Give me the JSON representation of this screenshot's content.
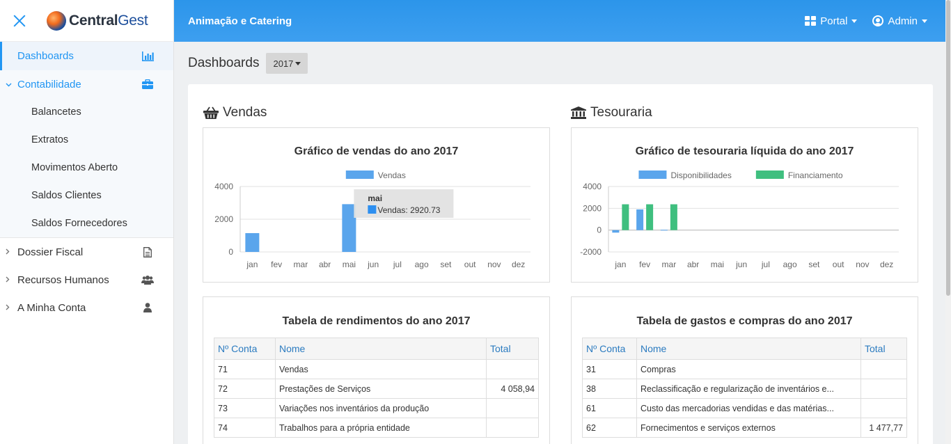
{
  "app": {
    "logo_main": "Central",
    "logo_accent": "Gest",
    "title": "Animação e Catering"
  },
  "topbar": {
    "portal_label": "Portal",
    "admin_label": "Admin"
  },
  "sidebar": {
    "items": [
      {
        "label": "Dashboards",
        "icon": "bar-chart-icon"
      },
      {
        "label": "Contabilidade",
        "icon": "briefcase-icon"
      },
      {
        "label": "Dossier Fiscal",
        "icon": "document-icon"
      },
      {
        "label": "Recursos Humanos",
        "icon": "users-icon"
      },
      {
        "label": "A Minha Conta",
        "icon": "user-icon"
      }
    ],
    "sub_items": [
      "Balancetes",
      "Extratos",
      "Movimentos Aberto",
      "Saldos Clientes",
      "Saldos Fornecedores"
    ]
  },
  "page": {
    "title": "Dashboards",
    "year": "2017"
  },
  "sections": {
    "vendas": "Vendas",
    "tesouraria": "Tesouraria"
  },
  "chart_data": [
    {
      "type": "bar",
      "title": "Gráfico de vendas do ano 2017",
      "categories": [
        "jan",
        "fev",
        "mar",
        "abr",
        "mai",
        "jun",
        "jul",
        "ago",
        "set",
        "out",
        "nov",
        "dez"
      ],
      "series": [
        {
          "name": "Vendas",
          "values": [
            1150,
            0,
            0,
            0,
            2920.73,
            0,
            0,
            0,
            0,
            0,
            0,
            0
          ],
          "color": "#5aa5ec"
        }
      ],
      "yticks": [
        0,
        2000,
        4000
      ],
      "ylim": [
        0,
        4000
      ],
      "legend": "top",
      "grid": true,
      "tooltip": {
        "title": "mai",
        "label": "Vendas: 2920.73",
        "category_index": 4
      }
    },
    {
      "type": "bar",
      "title": "Gráfico de tesouraria líquida do ano 2017",
      "categories": [
        "jan",
        "fev",
        "mar",
        "abr",
        "mai",
        "jun",
        "jul",
        "ago",
        "set",
        "out",
        "nov",
        "dez"
      ],
      "series": [
        {
          "name": "Disponibilidades",
          "values": [
            -230,
            1900,
            30,
            0,
            0,
            0,
            0,
            0,
            0,
            0,
            0,
            0
          ],
          "color": "#5aa5ec"
        },
        {
          "name": "Financiamento",
          "values": [
            2370,
            2370,
            2370,
            0,
            0,
            0,
            0,
            0,
            0,
            0,
            0,
            0
          ],
          "color": "#3fbf7f"
        }
      ],
      "yticks": [
        -2000,
        0,
        2000,
        4000
      ],
      "ylim": [
        -2000,
        4000
      ],
      "legend": "top",
      "grid": true
    }
  ],
  "tables": {
    "rendimentos": {
      "title": "Tabela de rendimentos do ano 2017",
      "columns": [
        "Nº Conta",
        "Nome",
        "Total"
      ],
      "rows": [
        [
          "71",
          "Vendas",
          ""
        ],
        [
          "72",
          "Prestações de Serviços",
          "4 058,94"
        ],
        [
          "73",
          "Variações nos inventários da produção",
          ""
        ],
        [
          "74",
          "Trabalhos para a própria entidade",
          ""
        ]
      ]
    },
    "gastos": {
      "title": "Tabela de gastos e compras do ano 2017",
      "columns": [
        "Nº Conta",
        "Nome",
        "Total"
      ],
      "rows": [
        [
          "31",
          "Compras",
          ""
        ],
        [
          "38",
          "Reclassificação e regularização de inventários e...",
          ""
        ],
        [
          "61",
          "Custo das mercadorias vendidas e das matérias...",
          ""
        ],
        [
          "62",
          "Fornecimentos e serviços externos",
          "1 477,77"
        ]
      ]
    }
  }
}
